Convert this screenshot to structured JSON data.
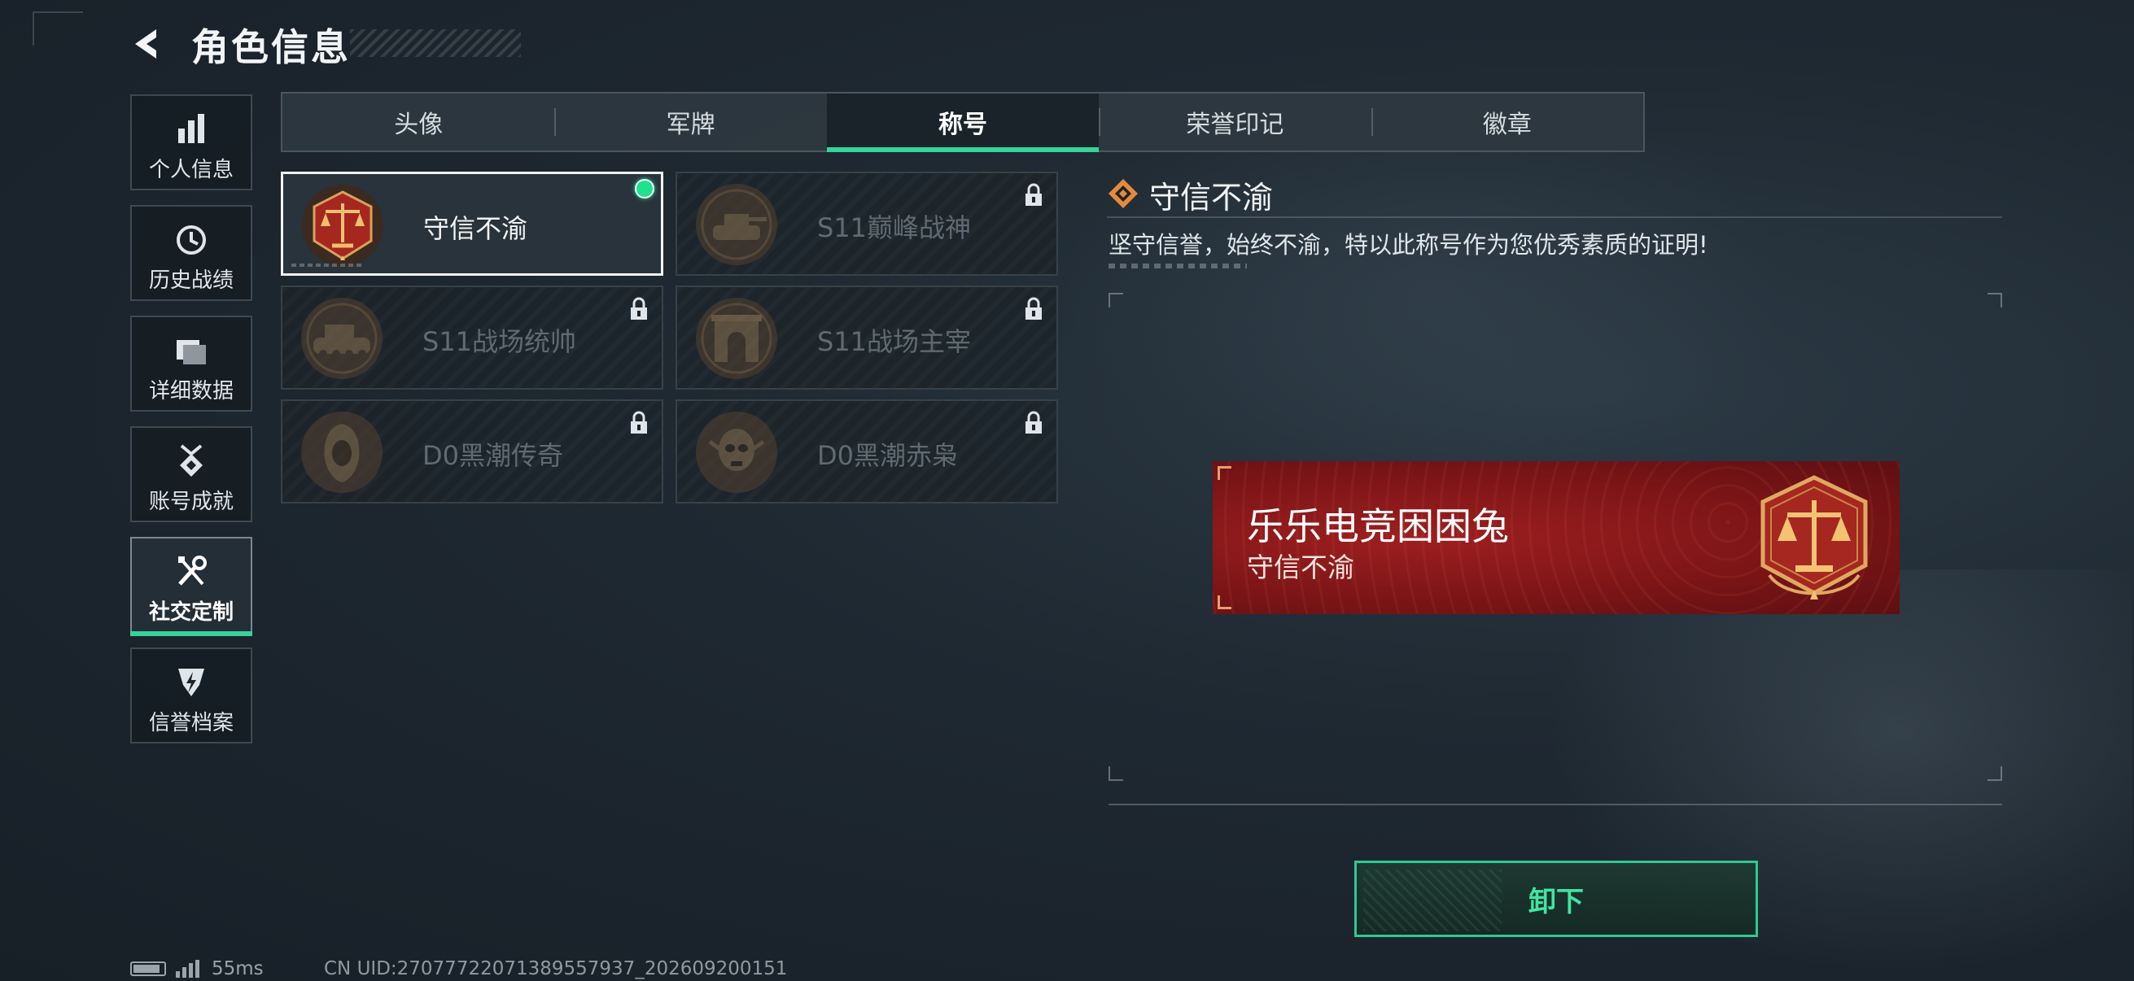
{
  "header": {
    "title": "角色信息",
    "back_icon": "back-arrow-icon"
  },
  "sidebar": {
    "items": [
      {
        "label": "个人信息",
        "icon": "bar-chart-icon",
        "active": false
      },
      {
        "label": "历史战绩",
        "icon": "history-clock-icon",
        "active": false
      },
      {
        "label": "详细数据",
        "icon": "folder-stack-icon",
        "active": false
      },
      {
        "label": "账号成就",
        "icon": "achievement-medal-icon",
        "active": false
      },
      {
        "label": "社交定制",
        "icon": "tools-wrench-icon",
        "active": true
      },
      {
        "label": "信誉档案",
        "icon": "credit-shield-icon",
        "active": false
      }
    ]
  },
  "tabs": [
    {
      "label": "头像",
      "active": false
    },
    {
      "label": "军牌",
      "active": false
    },
    {
      "label": "称号",
      "active": true
    },
    {
      "label": "荣誉印记",
      "active": false
    },
    {
      "label": "徽章",
      "active": false
    }
  ],
  "titles": [
    {
      "name": "守信不渝",
      "emblem": "scales-emblem-icon",
      "locked": false,
      "equipped": true,
      "selected": true
    },
    {
      "name": "S11巅峰战神",
      "emblem": "tank-emblem-icon",
      "locked": true
    },
    {
      "name": "S11战场统帅",
      "emblem": "armored-vehicle-emblem-icon",
      "locked": true
    },
    {
      "name": "S11战场主宰",
      "emblem": "arch-emblem-icon",
      "locked": true
    },
    {
      "name": "D0黑潮传奇",
      "emblem": "hooded-figure-emblem-icon",
      "locked": true
    },
    {
      "name": "D0黑潮赤枭",
      "emblem": "skull-mask-emblem-icon",
      "locked": true
    }
  ],
  "detail": {
    "title": "守信不渝",
    "description": "坚守信誉，始终不渝，特以此称号作为您优秀素质的证明!"
  },
  "preview": {
    "player_name": "乐乐电竞困困兔",
    "title": "守信不渝"
  },
  "actions": {
    "unequip_label": "卸下"
  },
  "status_bar": {
    "ping": "55ms",
    "uid": "CN UID:27077722071389557937_202609200151"
  },
  "colors": {
    "accent": "#36d39a",
    "banner_red": "#8a181a",
    "equipped_dot": "#1fe18e"
  }
}
